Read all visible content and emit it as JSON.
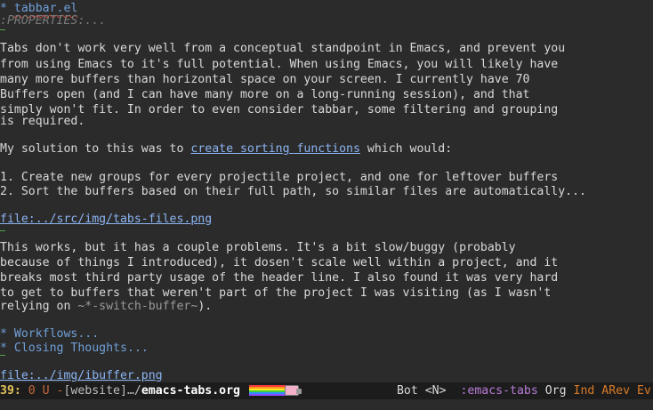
{
  "buffer": {
    "heading1_star": "*",
    "heading1_title": "tabbar.el",
    "properties": ":PROPERTIES:...",
    "para1": [
      "Tabs don't work very well from a conceptual standpoint in Emacs, and prevent you",
      "from using Emacs to it's full potential. When using Emacs, you will likely have",
      "many more buffers than horizontal space on your screen. I currently have 70",
      "Buffers open (and I can have many more on a long-running session), and that",
      "simply won't fit. In order to even consider tabbar, some filtering and grouping",
      "is required."
    ],
    "para2_before": "My solution to this was to ",
    "para2_link": "create sorting functions",
    "para2_after": " which would:",
    "list": [
      "1. Create new groups for every projectile project, and one for leftover buffers",
      "2. Sort the buffers based on their full path, so similar files are automatically..."
    ],
    "file_link1": "file:../src/img/tabs-files.png",
    "para3_lines": [
      "This works, but it has a couple problems. It's a bit slow/buggy (probably",
      "because of things I introduced), it dosen't scale well within a project, and it",
      "breaks most third party usage of the header line. I also found it was very hard",
      "to get to buffers that weren't part of the project I was visiting (as I wasn't"
    ],
    "para3_last_before": "relying on ",
    "para3_last_code": "~*-switch-buffer~",
    "para3_last_after": ").",
    "heading2_star": "*",
    "heading2_title": "Workflows...",
    "heading3_star": "*",
    "heading3_title": "Closing Thoughts...",
    "file_link2": "file:../img/ibuffer.png"
  },
  "modeline": {
    "line_number": "39",
    "colon": ":",
    "status": " 0 U -",
    "dir": "[website]…/",
    "filename": "emacs-tabs.org",
    "position": "Bot",
    "evil_state": "<N>",
    "project": ":emacs-tabs",
    "major_mode": "Org",
    "minor_modes": "Ind ARev Ev",
    "nyan_colors": [
      "#ff3b3b",
      "#ff9a1f",
      "#ffe81f",
      "#3bd13b",
      "#2f8dff",
      "#8a4dff"
    ]
  }
}
